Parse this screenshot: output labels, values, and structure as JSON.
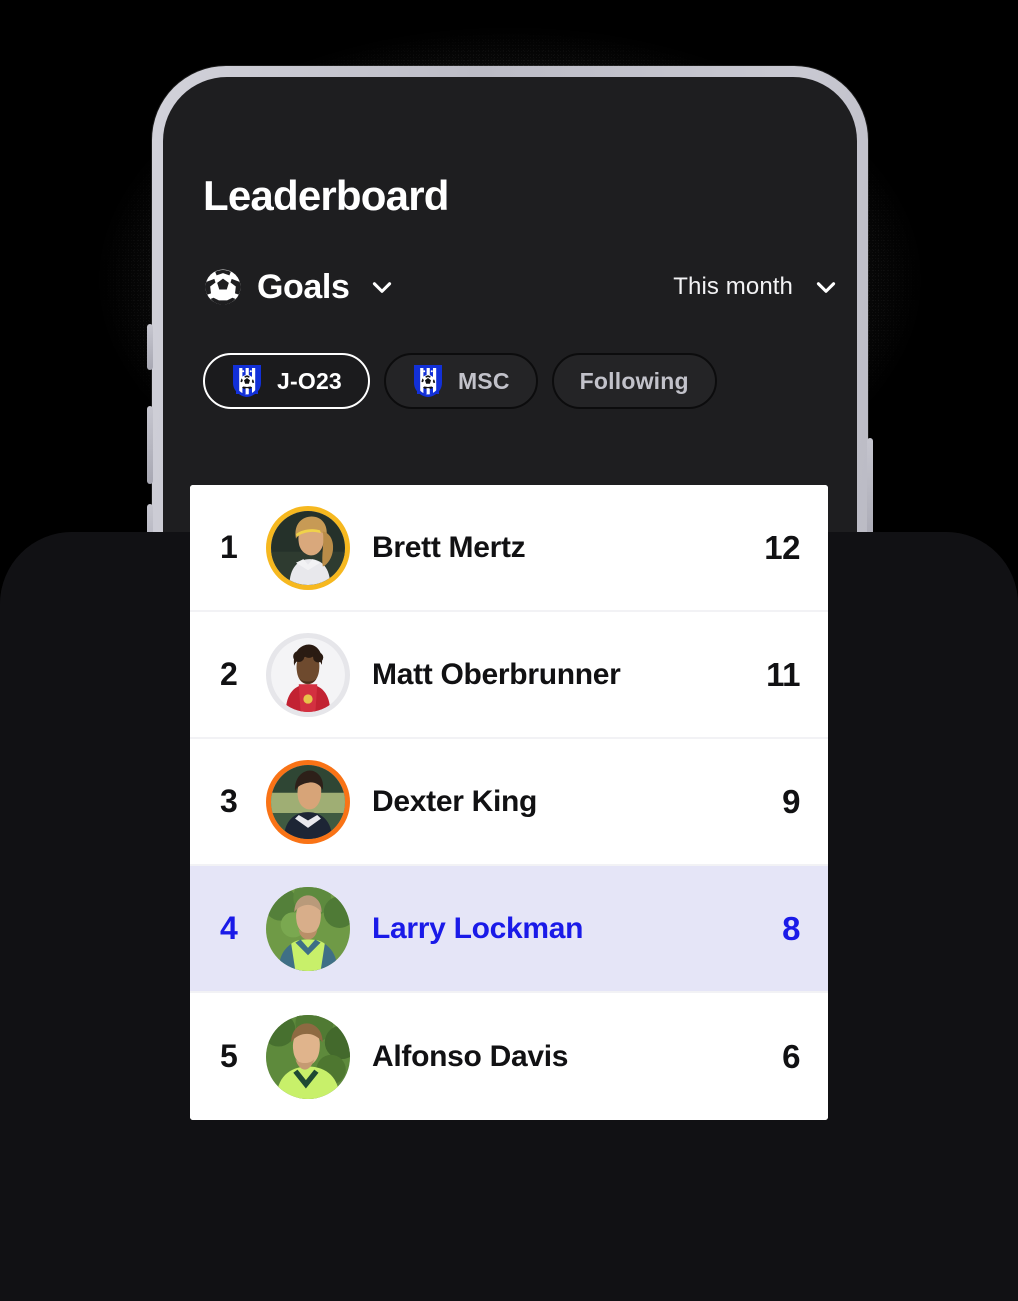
{
  "header": {
    "title": "Leaderboard"
  },
  "metric_selector": {
    "icon": "soccer-ball-icon",
    "label": "Goals",
    "chevron_icon": "chevron-down-icon"
  },
  "period_selector": {
    "label": "This month",
    "chevron_icon": "chevron-down-icon"
  },
  "filter_chips": [
    {
      "label": "J-O23",
      "badge_icon": "club-badge-icon",
      "active": true
    },
    {
      "label": "MSC",
      "badge_icon": "club-badge-icon",
      "active": false
    },
    {
      "label": "Following",
      "badge_icon": null,
      "active": false
    }
  ],
  "leaderboard": {
    "rows": [
      {
        "rank": "1",
        "name": "Brett Mertz",
        "score": "12",
        "ring_color": "#f6b81f",
        "highlighted": false
      },
      {
        "rank": "2",
        "name": "Matt Oberbrunner",
        "score": "11",
        "ring_color": "#e6e6ea",
        "highlighted": false
      },
      {
        "rank": "3",
        "name": "Dexter King",
        "score": "9",
        "ring_color": "#f97316",
        "highlighted": false
      },
      {
        "rank": "4",
        "name": "Larry Lockman",
        "score": "8",
        "ring_color": null,
        "highlighted": true
      },
      {
        "rank": "5",
        "name": "Alfonso Davis",
        "score": "6",
        "ring_color": null,
        "highlighted": false
      }
    ]
  },
  "colors": {
    "screen_background": "#1e1e20",
    "card_background": "#ffffff",
    "highlight_row_background": "#e5e5f7",
    "highlight_text": "#1a1ae8",
    "text_primary": "#111113",
    "chip_inactive_text": "#c2c2ca",
    "phone_bezel": "#c9c9d2",
    "foreground_panel": "#18181b"
  }
}
